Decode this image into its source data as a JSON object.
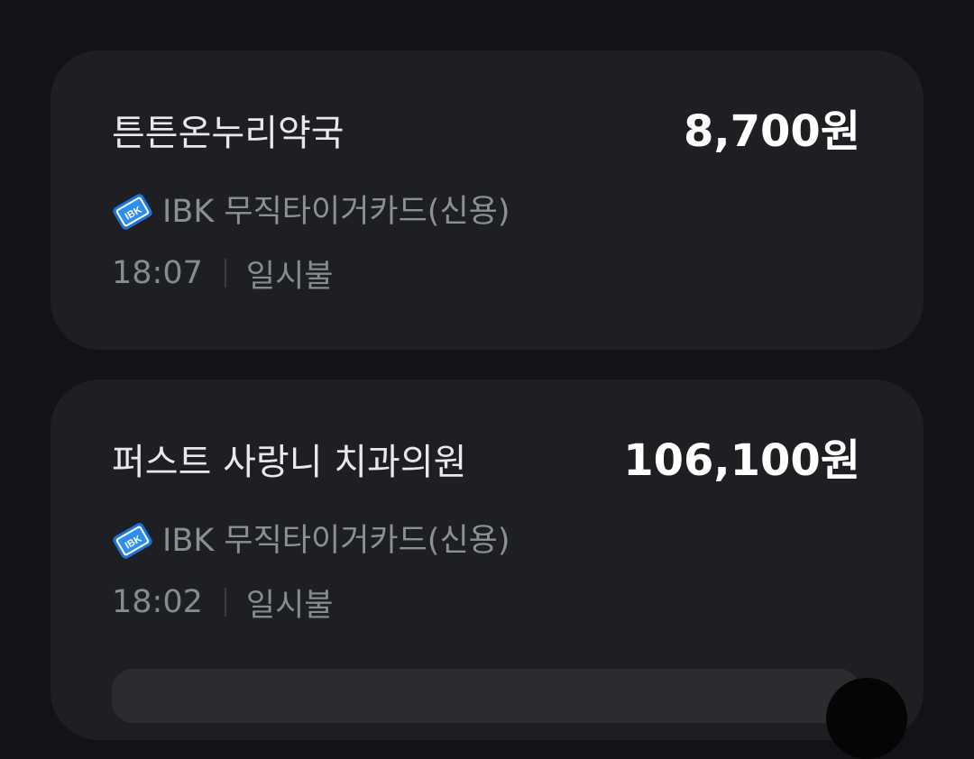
{
  "transactions": [
    {
      "merchant": "튼튼온누리약국",
      "amount": "8,700원",
      "card_name": "IBK 무직타이거카드(신용)",
      "card_logo_icon": "ibk-card-icon",
      "time": "18:07",
      "installment": "일시불"
    },
    {
      "merchant": "퍼스트 사랑니 치과의원",
      "amount": "106,100원",
      "card_name": "IBK 무직타이거카드(신용)",
      "card_logo_icon": "ibk-card-icon",
      "time": "18:02",
      "installment": "일시불"
    }
  ],
  "colors": {
    "background": "#121316",
    "card": "#1e1f22",
    "ibk_blue": "#1d74d8",
    "text_primary": "#ffffff",
    "text_secondary": "#8c8f96"
  }
}
